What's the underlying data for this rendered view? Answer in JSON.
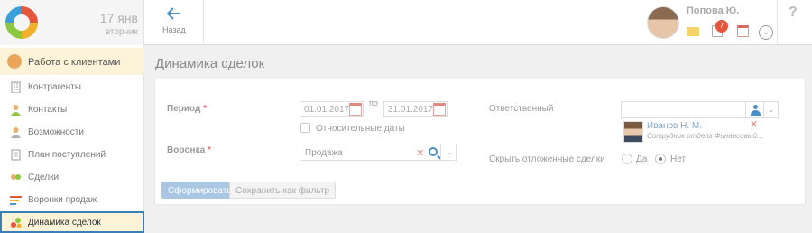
{
  "header": {
    "date_day": "17 янв",
    "date_weekday": "вторник",
    "back_label": "Назад",
    "user_name": "Попова Ю.",
    "task_badge": "7",
    "help": "?"
  },
  "sidebar": {
    "section_label": "Работа с клиентами",
    "items": [
      {
        "label": "Контрагенты",
        "icon": "building-icon"
      },
      {
        "label": "Контакты",
        "icon": "contact-icon"
      },
      {
        "label": "Возможности",
        "icon": "opportunity-icon"
      },
      {
        "label": "План поступлений",
        "icon": "document-icon"
      },
      {
        "label": "Сделки",
        "icon": "deals-icon"
      },
      {
        "label": "Воронки продаж",
        "icon": "funnel-icon"
      },
      {
        "label": "Динамика сделок",
        "icon": "dynamics-icon"
      }
    ]
  },
  "main": {
    "title": "Динамика сделок",
    "period_label": "Период",
    "required_mark": "*",
    "date_from": "01.01.2017",
    "date_to_sep": "по",
    "date_to": "31.01.2017",
    "relative_dates_label": "Относительные даты",
    "funnel_label": "Воронка",
    "funnel_value": "Продажа",
    "responsible_label": "Ответственный",
    "responsible_value": "",
    "person_name": "Иванов Н. М.",
    "person_position": "Сотрудник отдела Финансовый...",
    "hide_postponed_label": "Скрыть отложенные сделки",
    "radio_yes": "Да",
    "radio_no": "Нет",
    "radio_selected": "Нет",
    "generate_button": "Сформировать",
    "save_filter_button": "Сохранить как фильтр"
  },
  "colors": {
    "accent": "#3a7fb8",
    "section_bg": "#fdf3d9",
    "badge": "#e8553d"
  }
}
